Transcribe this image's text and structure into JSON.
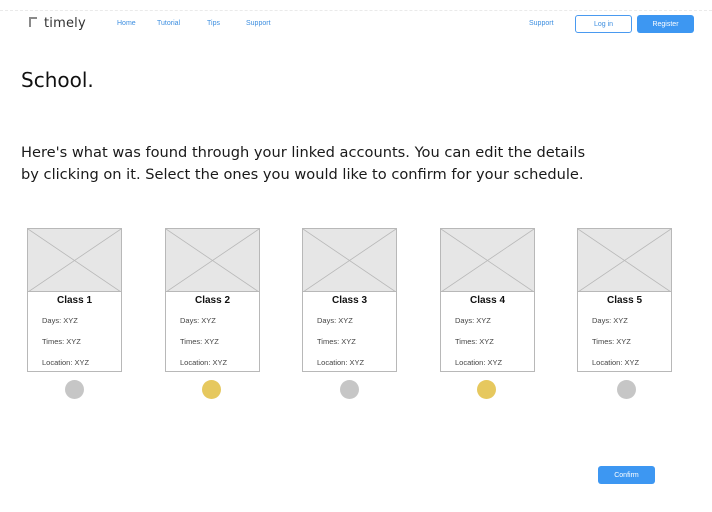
{
  "header": {
    "logo_text": "timely",
    "nav": [
      "Home",
      "Tutorial",
      "Tips",
      "Support"
    ],
    "support_link": "Support",
    "login_label": "Log in",
    "register_label": "Register"
  },
  "main": {
    "title": "School.",
    "intro_line1": "Here's what was found through your linked accounts. You can edit the details",
    "intro_line2": "by clicking on it. Select the ones you would like to confirm for your schedule.",
    "classes": [
      {
        "title": "Class 1",
        "days": "Days: XYZ",
        "times": "Times: XYZ",
        "location": "Location: XYZ",
        "selected": false
      },
      {
        "title": "Class 2",
        "days": "Days: XYZ",
        "times": "Times: XYZ",
        "location": "Location: XYZ",
        "selected": true
      },
      {
        "title": "Class 3",
        "days": "Days: XYZ",
        "times": "Times: XYZ",
        "location": "Location: XYZ",
        "selected": false
      },
      {
        "title": "Class 4",
        "days": "Days: XYZ",
        "times": "Times: XYZ",
        "location": "Location: XYZ",
        "selected": true
      },
      {
        "title": "Class 5",
        "days": "Days: XYZ",
        "times": "Times: XYZ",
        "location": "Location: XYZ",
        "selected": false
      }
    ],
    "confirm_label": "Confirm"
  },
  "colors": {
    "accent": "#3d97f2",
    "dot_selected": "#e6c85e",
    "dot_unselected": "#c6c6c6",
    "placeholder_bg": "#e6e6e6"
  },
  "icons": {
    "logo": "timely-logo-mark",
    "image_placeholder": "image-placeholder-icon"
  }
}
